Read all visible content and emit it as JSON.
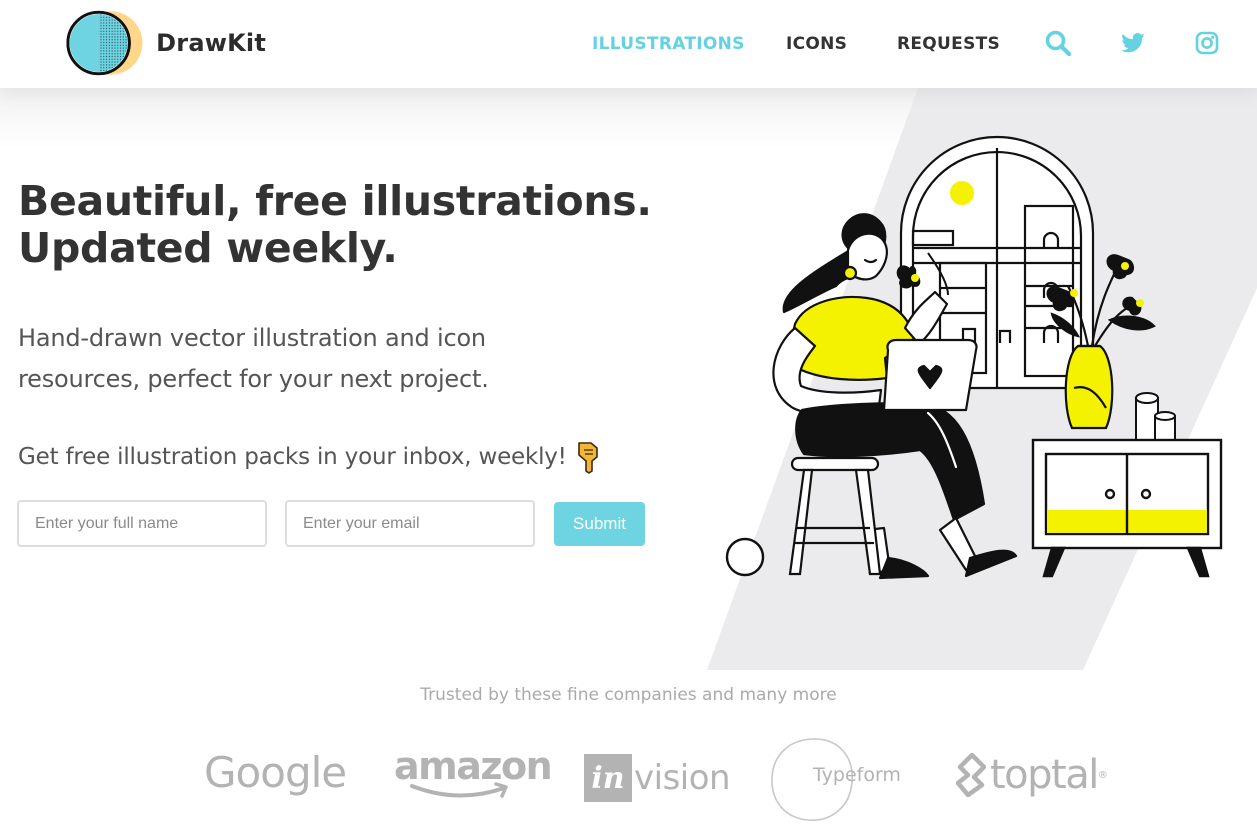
{
  "header": {
    "brand_name": "DrawKit",
    "nav": [
      {
        "label": "ILLUSTRATIONS",
        "active": true
      },
      {
        "label": "ICONS",
        "active": false
      },
      {
        "label": "REQUESTS",
        "active": false
      }
    ],
    "icons": [
      "search-icon",
      "twitter-icon",
      "instagram-icon"
    ]
  },
  "hero": {
    "headline_line1": "Beautiful, free illustrations.",
    "headline_line2": "Updated weekly.",
    "subhead_line1": "Hand-drawn vector illustration and icon",
    "subhead_line2": "resources, perfect for your next project.",
    "cta_text": "Get free illustration packs in your inbox, weekly!",
    "cta_icon": "pointing-down-hand-icon"
  },
  "signup": {
    "name_placeholder": "Enter your full name",
    "email_placeholder": "Enter your email",
    "submit_label": "Submit"
  },
  "trusted": {
    "caption": "Trusted by these fine companies and many more",
    "brands": {
      "google": "Google",
      "amazon": "amazon",
      "invision_box": "in",
      "invision_rest": "vision",
      "typeform": "Typeform",
      "toptal": "toptal",
      "toptal_reg": "®"
    }
  },
  "colors": {
    "accent": "#64d2e0",
    "yellow": "#f5f200",
    "logo_orange": "#ffd68a",
    "text_dark": "#333333",
    "backdrop": "#ebebed"
  }
}
